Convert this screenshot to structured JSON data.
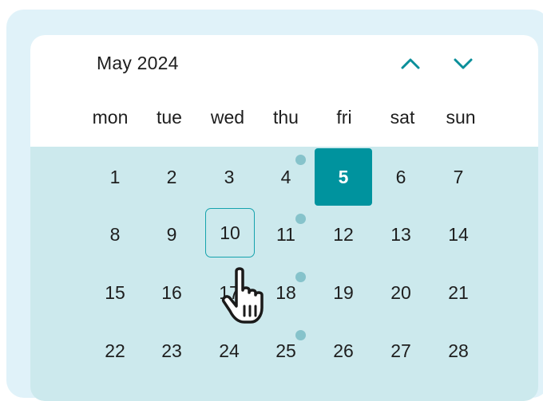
{
  "calendar": {
    "month_label": "May 2024",
    "nav": {
      "prev_icon": "chevron-up-icon",
      "next_icon": "chevron-down-icon"
    },
    "weekdays": [
      "mon",
      "tue",
      "wed",
      "thu",
      "fri",
      "sat",
      "sun"
    ],
    "days": [
      [
        "1",
        "2",
        "3",
        "4",
        "5",
        "6",
        "7"
      ],
      [
        "8",
        "9",
        "10",
        "11",
        "12",
        "13",
        "14"
      ],
      [
        "15",
        "16",
        "17",
        "18",
        "19",
        "20",
        "21"
      ],
      [
        "22",
        "23",
        "24",
        "25",
        "26",
        "27",
        "28"
      ]
    ],
    "selected_day": "5",
    "focused_day": "10",
    "days_with_events": [
      "4",
      "11",
      "18",
      "25"
    ],
    "cursor_icon": "hand-pointer-icon"
  },
  "colors": {
    "accent": "#00939e",
    "grid_background": "#cce9ed",
    "outer_background": "#e0f2f9",
    "event_dot": "#86c3cb",
    "chevron": "#0a8f9a"
  }
}
